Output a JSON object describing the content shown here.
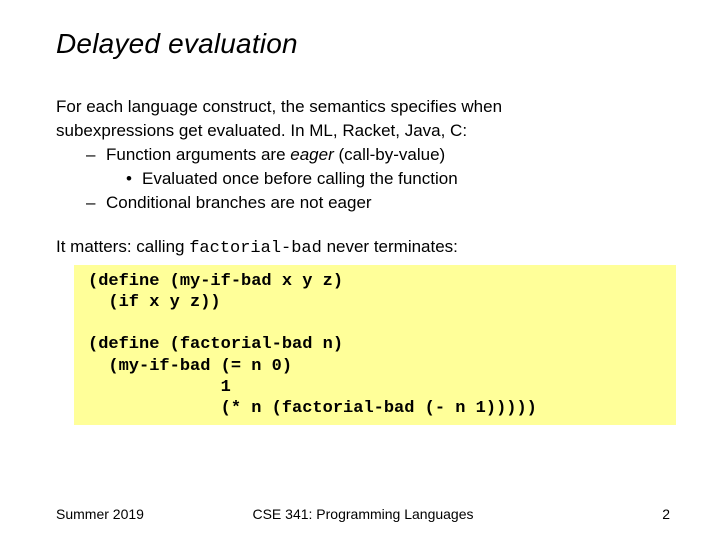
{
  "title": "Delayed evaluation",
  "p1a": "For each language construct, the semantics specifies when",
  "p1b": "subexpressions get evaluated.  In ML, Racket, Java, C:",
  "b1a": "Function arguments are ",
  "b1eager": "eager",
  "b1b": " (call-by-value)",
  "b1sub": "Evaluated once before calling the function",
  "b2": "Conditional branches are not eager",
  "mattersA": "It matters: calling ",
  "mattersCode": "factorial-bad",
  "mattersB": " never terminates:",
  "code": "(define (my-if-bad x y z)\n  (if x y z))\n\n(define (factorial-bad n)\n  (my-if-bad (= n 0)\n             1\n             (* n (factorial-bad (- n 1)))))",
  "footerLeft": "Summer 2019",
  "footerCenter": "CSE 341: Programming Languages",
  "footerRight": "2"
}
